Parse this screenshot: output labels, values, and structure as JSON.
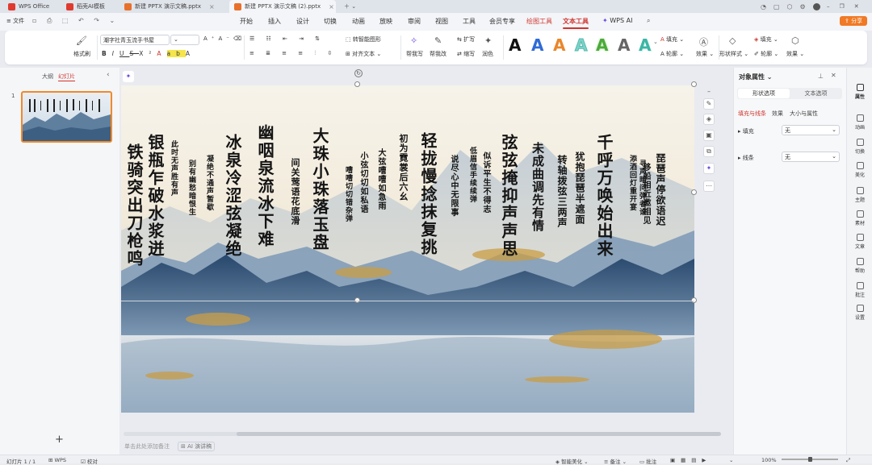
{
  "tabs": [
    {
      "label": "WPS Office",
      "color": "#e03a2f"
    },
    {
      "label": "稻壳AI模板",
      "color": "#e03a2f"
    },
    {
      "label": "新建 PPTX 演示文稿.pptx",
      "color": "#e8702a"
    },
    {
      "label": "新建 PPTX 演示文稿 (2).pptx",
      "color": "#e8702a"
    }
  ],
  "menu": {
    "file": "文件",
    "items": [
      "开始",
      "插入",
      "设计",
      "切换",
      "动画",
      "放映",
      "审阅",
      "视图",
      "工具",
      "会员专享",
      "绘图工具",
      "文本工具",
      "WPS AI"
    ],
    "active_index": 11,
    "share": "分享"
  },
  "ribbon": {
    "format_painter": "格式刷",
    "font_name": "潮字社青玉流手书屋",
    "font_size": "",
    "smart_shape": "转智能图形",
    "align_text": "对齐文本",
    "help_write": "帮我写",
    "help_edit": "帮我改",
    "expand": "扩写",
    "shorten": "缩写",
    "polish": "润色",
    "text_styles": [
      "A",
      "A",
      "A",
      "A",
      "A",
      "A",
      "A"
    ],
    "text_style_colors": [
      "#111111",
      "#2f6bd6",
      "#e8872c",
      "#7bd3c9",
      "#4caa3a",
      "#666666",
      "#3bb6a5"
    ],
    "fill": "填充",
    "outline": "轮廓",
    "effect": "效果",
    "shape_style": "形状样式",
    "shape_fill": "填充",
    "shape_outline": "轮廓",
    "shape_effect": "效果"
  },
  "left_panel": {
    "tab_outline": "大纲",
    "tab_slides": "幻灯片",
    "slide_number": "1",
    "add_slide": "+"
  },
  "slide": {
    "poem_columns": [
      {
        "text": "铁骑突出刀枪鸣",
        "size": 20
      },
      {
        "text": "银瓶乍破水浆迸",
        "size": 20
      },
      {
        "text": "此时无声胜有声",
        "size": 9
      },
      {
        "text": "别有幽愁暗恨生",
        "size": 9
      },
      {
        "text": "凝绝不通声暂歇",
        "size": 9
      },
      {
        "text": "冰泉冷涩弦凝绝",
        "size": 20
      },
      {
        "text": "幽咽泉流冰下难",
        "size": 20
      },
      {
        "text": "间关莺语花底滑",
        "size": 11
      },
      {
        "text": "大珠小珠落玉盘",
        "size": 20
      },
      {
        "text": "嘈嘈切切错杂弹",
        "size": 9
      },
      {
        "text": "小弦切切如私语",
        "size": 10
      },
      {
        "text": "大弦嘈嘈如急雨",
        "size": 10
      },
      {
        "text": "初为霓裳后六幺",
        "size": 11
      },
      {
        "text": "轻拢慢捻抹复挑",
        "size": 20
      },
      {
        "text": "说尽心中无限事",
        "size": 10
      },
      {
        "text": "低眉信手续续弹",
        "size": 9
      },
      {
        "text": "似诉平生不得志",
        "size": 10
      },
      {
        "text": "弦弦掩抑声声思",
        "size": 20
      },
      {
        "text": "未成曲调先有情",
        "size": 15
      },
      {
        "text": "转轴拨弦三两声",
        "size": 12
      },
      {
        "text": "犹抱琵琶半遮面",
        "size": 12
      },
      {
        "text": "千呼万唤始出来",
        "size": 20
      },
      {
        "text": "寻声暗问弹者谁",
        "size": 9
      },
      {
        "text": "琵琶声停欲语迟",
        "size": 12
      },
      {
        "text": "移船相近邀相见",
        "size": 10
      },
      {
        "text": "添酒回灯重开宴",
        "size": 9
      }
    ],
    "notes_placeholder": "单击此处添加备注",
    "ai_speech": "AI 演讲稿"
  },
  "right_panel": {
    "title": "对象属性",
    "tab_shape": "形状选项",
    "tab_text": "文本选项",
    "sub_fill_line": "填充与线条",
    "sub_effect": "效果",
    "sub_size": "大小与属性",
    "fill_label": "填充",
    "fill_value": "无",
    "line_label": "线条",
    "line_value": "无"
  },
  "sidebar": [
    "属性",
    "动画",
    "切换",
    "美化",
    "主题",
    "素材",
    "文章",
    "帮助",
    "批注",
    "设置"
  ],
  "status": {
    "slide_info": "幻灯片 1 / 1",
    "theme": "WPS",
    "proof": "校对",
    "smart_beautify": "智能美化",
    "notes": "备注",
    "comments": "批注",
    "zoom": "100%"
  },
  "colors": {
    "accent": "#d0342c",
    "share": "#f07a25",
    "selection": "#f08a2a"
  }
}
